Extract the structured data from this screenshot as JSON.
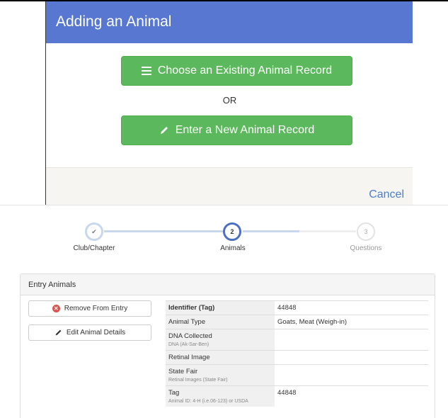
{
  "modal": {
    "title": "Adding an Animal",
    "choose_label": "Choose an Existing Animal Record",
    "or_label": "OR",
    "enter_label": "Enter a New Animal Record",
    "cancel_label": "Cancel",
    "header_color": "#5777d1",
    "button_color": "#5cb85c"
  },
  "stepper": {
    "steps": [
      {
        "number": "✔",
        "label": "Club/Chapter",
        "state": "completed"
      },
      {
        "number": "2",
        "label": "Animals",
        "state": "active"
      },
      {
        "number": "3",
        "label": "Questions",
        "state": "upcoming"
      }
    ]
  },
  "panel": {
    "title": "Entry Animals",
    "remove_label": "Remove From Entry",
    "edit_label": "Edit Animal Details",
    "rows": [
      {
        "label": "Identifier (Tag)",
        "sub": "",
        "value": "44848"
      },
      {
        "label": "Animal Type",
        "sub": "",
        "value": "Goats, Meat (Weigh-in)"
      },
      {
        "label": "DNA Collected",
        "sub": "DNA (Ak-Sar-Ben)",
        "value": ""
      },
      {
        "label": "Retinal Image",
        "sub": "",
        "value": ""
      },
      {
        "label": "State Fair",
        "sub": "Retinal Images (State Fair)",
        "value": ""
      },
      {
        "label": "Tag",
        "sub": "Animal ID: 4-H (i.e.06-123) or USDA",
        "value": "44848"
      }
    ]
  }
}
